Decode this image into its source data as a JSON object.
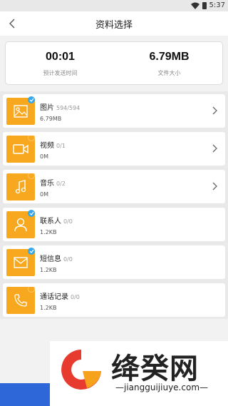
{
  "status_bar": {
    "time": "5:37"
  },
  "header": {
    "title": "资料选择"
  },
  "summary": {
    "time_value": "00:01",
    "time_label": "预计发送时间",
    "size_value": "6.79MB",
    "size_label": "文件大小"
  },
  "items": [
    {
      "name": "图片",
      "count": "594/594",
      "size": "6.79MB",
      "checked": true,
      "has_chevron": true,
      "icon": "image-icon"
    },
    {
      "name": "视频",
      "count": "0/1",
      "size": "0M",
      "checked": false,
      "has_chevron": true,
      "icon": "video-icon"
    },
    {
      "name": "音乐",
      "count": "0/2",
      "size": "0M",
      "checked": false,
      "has_chevron": true,
      "icon": "music-icon"
    },
    {
      "name": "联系人",
      "count": "0/0",
      "size": "1.2KB",
      "checked": true,
      "has_chevron": false,
      "icon": "contact-icon"
    },
    {
      "name": "短信息",
      "count": "0/0",
      "size": "1.2KB",
      "checked": true,
      "has_chevron": false,
      "icon": "message-icon"
    },
    {
      "name": "通话记录",
      "count": "0/0",
      "size": "1.2KB",
      "checked": false,
      "has_chevron": false,
      "icon": "phone-icon"
    }
  ],
  "watermark": {
    "text": "绛癸网",
    "url": "—jiangguijiuye.com—"
  },
  "colors": {
    "accent": "#f7a81e",
    "check": "#31a8f0",
    "bottom_button": "#2e67d8"
  }
}
